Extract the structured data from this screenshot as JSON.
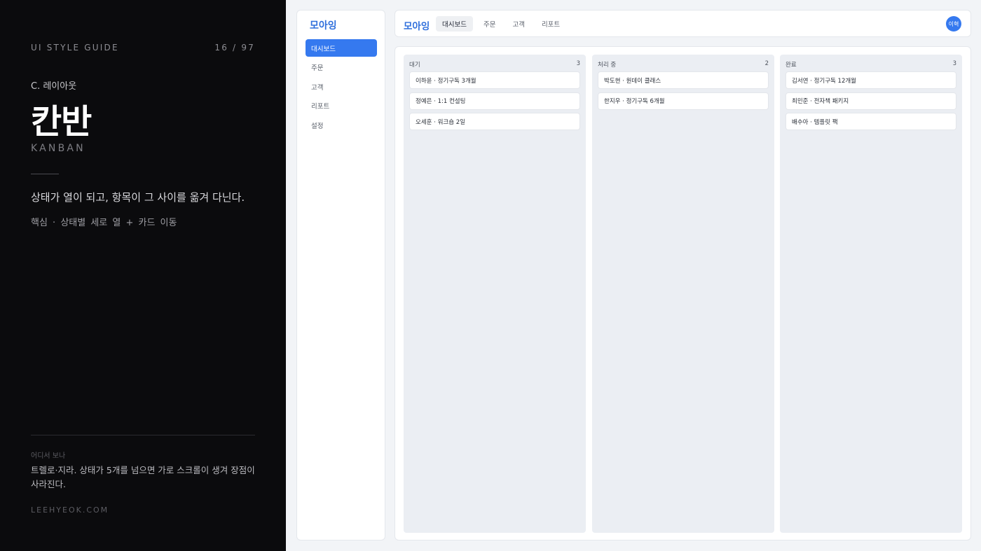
{
  "guide": {
    "header_left": "UI STYLE GUIDE",
    "header_right": "16 / 97",
    "section": "C. 레이아웃",
    "title": "칸반",
    "subtitle": "KANBAN",
    "description": "상태가 열이 되고, 항목이 그 사이를 옮겨 다닌다.",
    "core": "핵심 · 상태별 세로 열 + 카드 이동",
    "where_label": "어디서 보나",
    "where_text": "트렐로·지라. 상태가 5개를 넘으면 가로 스크롤이 생겨 장점이 사라진다.",
    "site": "LEEHYEOK.COM"
  },
  "app": {
    "brand": "모아잉",
    "nav": [
      {
        "label": "대시보드",
        "active": true
      },
      {
        "label": "주문"
      },
      {
        "label": "고객"
      },
      {
        "label": "리포트"
      },
      {
        "label": "설정"
      }
    ],
    "topbar": {
      "brand": "모아잉",
      "tabs": [
        {
          "label": "대시보드",
          "active": true
        },
        {
          "label": "주문"
        },
        {
          "label": "고객"
        },
        {
          "label": "리포트"
        }
      ],
      "avatar": "이혁"
    },
    "columns": [
      {
        "title": "대기",
        "count": "3",
        "cards": [
          "이하윤 · 정기구독 3개월",
          "정예은 · 1:1 컨설팅",
          "오세훈 · 워크숍 2일"
        ]
      },
      {
        "title": "처리 중",
        "count": "2",
        "cards": [
          "박도현 · 원데이 클래스",
          "한지우 · 정기구독 6개월"
        ]
      },
      {
        "title": "완료",
        "count": "3",
        "cards": [
          "김서연 · 정기구독 12개월",
          "최민준 · 전자책 패키지",
          "배수아 · 템플릿 팩"
        ]
      }
    ],
    "colors": {
      "accent": "#3579ef",
      "brand": "#2f6fdc",
      "guide_bg": "#0b0b0d",
      "column_bg": "#ebeef3"
    }
  }
}
